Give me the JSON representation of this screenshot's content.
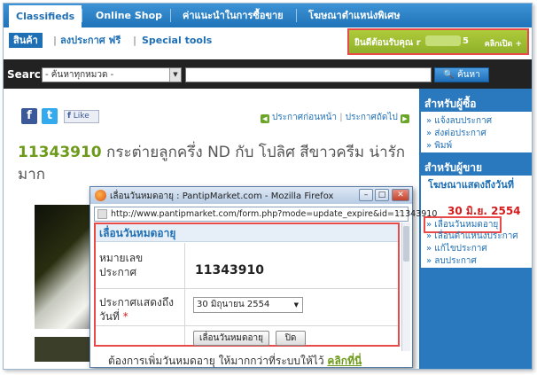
{
  "tabs": [
    "Classifieds",
    "Online Shop",
    "ค่าแนะนำในการซื้อขาย",
    "โฆษณาตำแหน่งพิเศษ"
  ],
  "subnav": {
    "products": "สินค้า",
    "post_free": "ลงประกาศ ฟรี",
    "special_tools": "Special tools",
    "welcome": "ยินดีต้อนรับคุณ r",
    "welcome_suffix": "5",
    "open": "คลิกเปิด +"
  },
  "search": {
    "label": "Search",
    "category": "- ค้นหาทุกหมวด -",
    "button": "ค้นหา"
  },
  "share": {
    "facebook_glyph": "f",
    "twitter_glyph": "t",
    "like": "Like"
  },
  "pagenav": {
    "prev": "ประกาศก่อนหน้า",
    "separator": "|",
    "next": "ประกาศถัดไป"
  },
  "post": {
    "id": "11343910",
    "title": "กระต่ายลูกครึ่ง ND กับ โปลิศ สีขาวครีม น่ารัก มาก"
  },
  "sidebar": {
    "buyer_heading": "สำหรับผู้ซื้อ",
    "buyer_items": [
      "แจ้งลบประกาศ",
      "ส่งต่อประกาศ",
      "พิมพ์"
    ],
    "seller_heading": "สำหรับผู้ขาย",
    "ad_display_label": "โฆษณาแสดงถึงวันที่",
    "ad_display_date": "30 มิ.ย. 2554",
    "seller_items": [
      "เลื่อนวันหมดอายุ",
      "เลื่อนตำแหน่งประกาศ",
      "แก้ไขประกาศ",
      "ลบประกาศ"
    ]
  },
  "popup": {
    "window_title": "เลื่อนวันหมดอายุ : PantipMarket.com - Mozilla Firefox",
    "url": "http://www.pantipmarket.com/form.php?mode=update_expire&id=11343910",
    "header": "เลื่อนวันหมดอายุ",
    "label_id": "หมายเลข ประกาศ",
    "value_id": "11343910",
    "label_date": "ประกาศแสดงถึง วันที่",
    "required_mark": "*",
    "date_value": "30 มิถุนายน 2554",
    "btn_extend": "เลื่อนวันหมดอายุ",
    "btn_close": "ปิด",
    "bottom_text": "ต้องการเพิ่มวันหมดอายุ ให้มากกว่าที่ระบบให้ไว้",
    "bottom_link": "คลิกที่นี่"
  }
}
